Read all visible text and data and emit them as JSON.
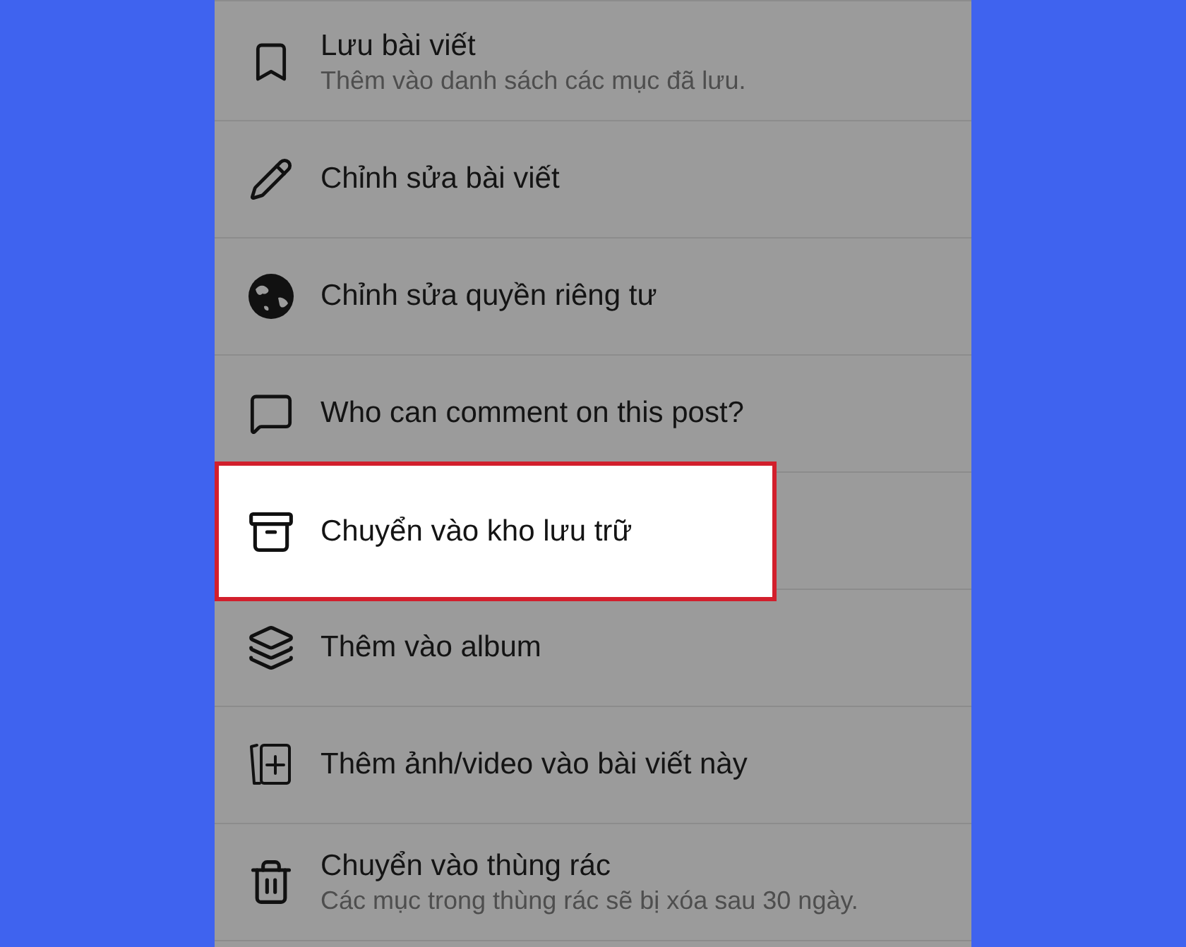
{
  "menu": {
    "items": [
      {
        "title": "Lưu bài viết",
        "subtitle": "Thêm vào danh sách các mục đã lưu.",
        "selected": false
      },
      {
        "title": "Chỉnh sửa bài viết",
        "selected": false
      },
      {
        "title": "Chỉnh sửa quyền riêng tư",
        "selected": false
      },
      {
        "title": "Who can comment on this post?",
        "selected": false
      },
      {
        "title": "Chuyển vào kho lưu trữ",
        "selected": true
      },
      {
        "title": "Thêm vào album",
        "selected": false
      },
      {
        "title": "Thêm ảnh/video vào bài viết này",
        "selected": false
      },
      {
        "title": "Chuyển vào thùng rác",
        "subtitle": "Các mục trong thùng rác sẽ bị xóa sau 30 ngày.",
        "selected": false
      }
    ]
  }
}
